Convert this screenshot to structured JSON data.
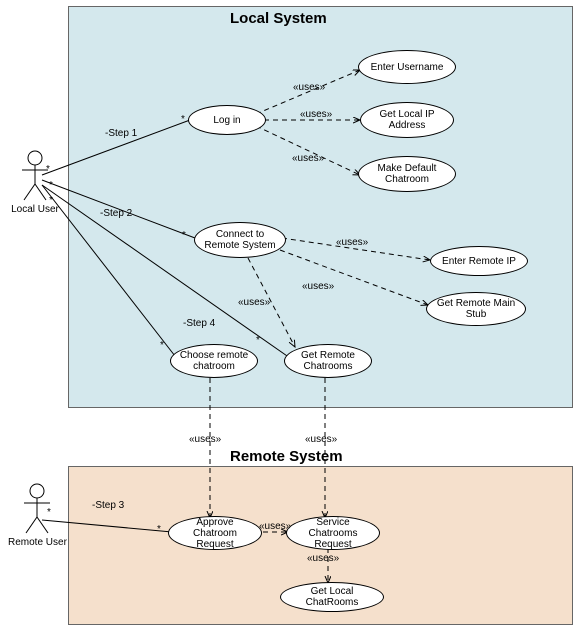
{
  "chart_data": {
    "type": "diagram",
    "diagram_type": "uml-use-case",
    "systems": [
      {
        "name": "Local System",
        "actor": "Local User",
        "use_cases": [
          "Log in",
          "Connect to Remote System",
          "Choose remote chatroom",
          "Get Remote Chatrooms",
          "Enter Username",
          "Get Local IP Address",
          "Make Default Chatroom",
          "Enter Remote IP",
          "Get Remote Main Stub"
        ]
      },
      {
        "name": "Remote System",
        "actor": "Remote User",
        "use_cases": [
          "Approve Chatroom Request",
          "Service Chatrooms Request",
          "Get Local ChatRooms"
        ]
      }
    ],
    "associations": [
      {
        "from": "Local User",
        "to": "Log in",
        "label": "-Step 1"
      },
      {
        "from": "Local User",
        "to": "Connect to Remote System",
        "label": "-Step 2"
      },
      {
        "from": "Local User",
        "to": "Choose remote chatroom",
        "label": "-Step 4"
      },
      {
        "from": "Local User",
        "to": "Get Remote Chatrooms"
      },
      {
        "from": "Remote User",
        "to": "Approve Chatroom Request",
        "label": "-Step 3"
      }
    ],
    "uses_relationships": [
      {
        "from": "Log in",
        "to": "Enter Username"
      },
      {
        "from": "Log in",
        "to": "Get Local IP Address"
      },
      {
        "from": "Log in",
        "to": "Make Default Chatroom"
      },
      {
        "from": "Connect to Remote System",
        "to": "Enter Remote IP"
      },
      {
        "from": "Connect to Remote System",
        "to": "Get Remote Main Stub"
      },
      {
        "from": "Connect to Remote System",
        "to": "Get Remote Chatrooms"
      },
      {
        "from": "Choose remote chatroom",
        "to": "Approve Chatroom Request"
      },
      {
        "from": "Get Remote Chatrooms",
        "to": "Service Chatrooms Request"
      },
      {
        "from": "Approve Chatroom Request",
        "to": "Service Chatrooms Request"
      },
      {
        "from": "Service Chatrooms Request",
        "to": "Get Local ChatRooms"
      }
    ]
  },
  "titles": {
    "local": "Local System",
    "remote": "Remote System"
  },
  "actors": {
    "local": "Local User",
    "remote": "Remote User"
  },
  "usecases": {
    "login": "Log in",
    "connect": "Connect to Remote System",
    "choose": "Choose remote chatroom",
    "getremote": "Get Remote Chatrooms",
    "enteruser": "Enter Username",
    "getip": "Get Local IP Address",
    "makedefault": "Make Default Chatroom",
    "enterremoteip": "Enter Remote IP",
    "getstub": "Get Remote Main Stub",
    "approve": "Approve Chatroom Request",
    "service": "Service Chatrooms Request",
    "getlocalrooms": "Get Local ChatRooms"
  },
  "labels": {
    "step1": "-Step 1",
    "step2": "-Step 2",
    "step3": "-Step 3",
    "step4": "-Step 4",
    "uses": "«uses»",
    "star": "*"
  }
}
